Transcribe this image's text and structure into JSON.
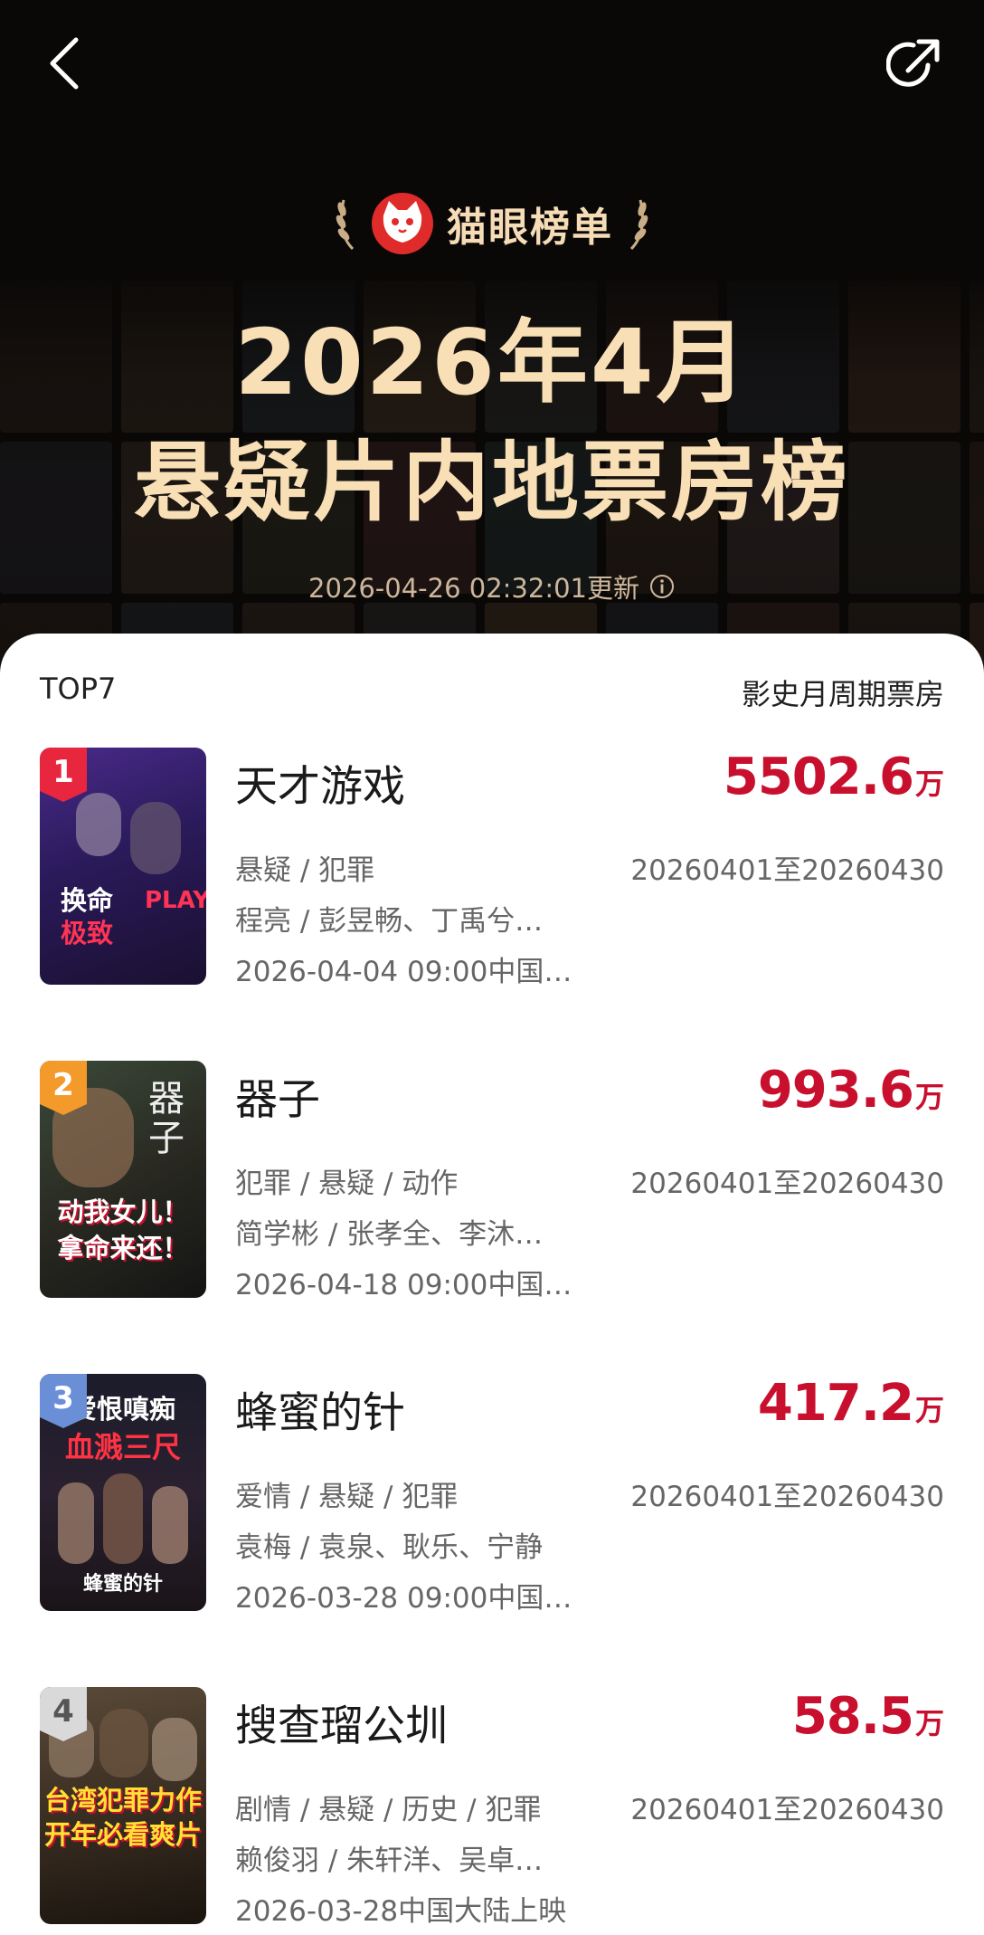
{
  "header": {
    "brand": "猫眼榜单",
    "title_line1": "2026年4月",
    "title_line2": "悬疑片内地票房榜",
    "updated": "2026-04-26 02:32:01更新",
    "icons": [
      "back-arrow-icon",
      "share-icon",
      "maoyan-cat-logo",
      "laurel-icon",
      "info-icon"
    ]
  },
  "list": {
    "top_label": "TOP7",
    "period_label": "影史月周期票房",
    "items": [
      {
        "rank": "1",
        "title": "天才游戏",
        "box_value": "5502.6",
        "box_unit": "万",
        "genre": "悬疑 / 犯罪",
        "range": "20260401至20260430",
        "cast": "程亮 / 彭昱畅、丁禹兮…",
        "release": "2026-04-04 09:00中国…",
        "poster_text1": "换命",
        "poster_text2": "PLAY",
        "poster_text3": "极致"
      },
      {
        "rank": "2",
        "title": "器子",
        "box_value": "993.6",
        "box_unit": "万",
        "genre": "犯罪 / 悬疑 / 动作",
        "range": "20260401至20260430",
        "cast": "简学彬 / 张孝全、李沐…",
        "release": "2026-04-18 09:00中国…",
        "poster_text1": "动我女儿！",
        "poster_text2": "拿命来还！"
      },
      {
        "rank": "3",
        "title": "蜂蜜的针",
        "box_value": "417.2",
        "box_unit": "万",
        "genre": "爱情 / 悬疑 / 犯罪",
        "range": "20260401至20260430",
        "cast": "袁梅 / 袁泉、耿乐、宁静",
        "release": "2026-03-28 09:00中国…",
        "poster_text1": "爱恨嗔痴",
        "poster_text2": "血溅三尺",
        "poster_text3": "蜂蜜的针"
      },
      {
        "rank": "4",
        "title": "搜查瑠公圳",
        "box_value": "58.5",
        "box_unit": "万",
        "genre": "剧情 / 悬疑 / 历史 / 犯罪",
        "range": "20260401至20260430",
        "cast": "赖俊羽 / 朱轩洋、吴卓…",
        "release": "2026-03-28中国大陆上映",
        "poster_text1": "台湾犯罪力作",
        "poster_text2": "开年必看爽片"
      }
    ]
  },
  "colors": {
    "accent_red": "#c8102e",
    "title_gold": "#f8dfb6",
    "rank1": "#e8273f",
    "rank2": "#f49a2a",
    "rank3": "#6b8fd6",
    "rank4": "#d9d9d9"
  }
}
